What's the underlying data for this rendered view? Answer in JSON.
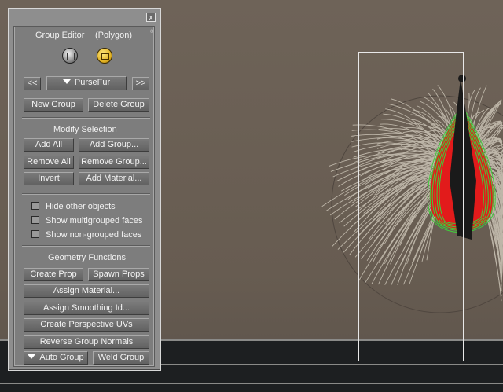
{
  "panel": {
    "close_label": "x",
    "title_left": "Group Editor",
    "title_right": "(Polygon)",
    "corner_mark": "o",
    "prev_label": "<<",
    "next_label": ">>",
    "group_name": "PurseFur",
    "new_group": "New Group",
    "delete_group": "Delete Group",
    "modify_heading": "Modify Selection",
    "add_all": "Add All",
    "add_group": "Add Group...",
    "remove_all": "Remove All",
    "remove_group": "Remove Group...",
    "invert": "Invert",
    "add_material": "Add Material...",
    "checkboxes": [
      {
        "label": "Hide other objects",
        "checked": false
      },
      {
        "label": "Show multigrouped faces",
        "checked": false
      },
      {
        "label": "Show non-grouped faces",
        "checked": false
      }
    ],
    "geometry_heading": "Geometry Functions",
    "create_prop": "Create Prop",
    "spawn_props": "Spawn Props",
    "assign_material": "Assign Material...",
    "assign_smoothing": "Assign Smoothing Id...",
    "create_uvs": "Create Perspective UVs",
    "reverse_normals": "Reverse Group Normals",
    "auto_group": "Auto Group",
    "weld_group": "Weld Group",
    "icons": [
      "polygon-select-icon",
      "group-mode-icon"
    ]
  },
  "colors": {
    "panel_bg": "#8e8e8e",
    "accent_gold": "#e0b020",
    "selection_red": "#e02020",
    "selection_green": "#40d040"
  }
}
